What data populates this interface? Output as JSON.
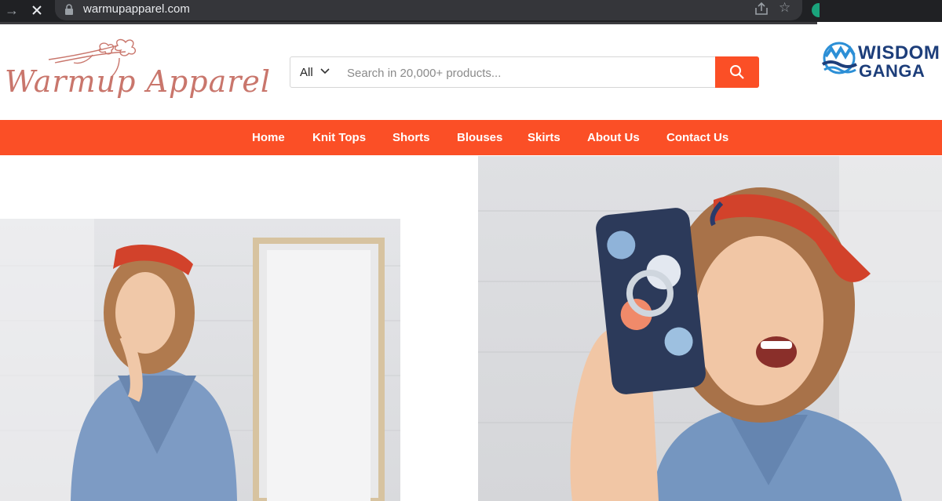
{
  "browser": {
    "url": "warmupapparel.com",
    "icons": [
      "back-arrow-icon",
      "stop-icon",
      "lock-icon",
      "share-icon",
      "bookmark-star-icon"
    ]
  },
  "watermark": {
    "line1": "WISDOM",
    "line2": "GANGA",
    "colors": {
      "navy": "#1d3e7a",
      "blue": "#2c8fd6"
    }
  },
  "header": {
    "logo_text": "Warmup Apparel",
    "search": {
      "category": "All",
      "placeholder": "Search in 20,000+ products..."
    }
  },
  "nav": {
    "items": [
      {
        "label": "Home"
      },
      {
        "label": "Knit Tops"
      },
      {
        "label": "Shorts"
      },
      {
        "label": "Blouses"
      },
      {
        "label": "Skirts"
      },
      {
        "label": "About Us"
      },
      {
        "label": "Contact Us"
      }
    ]
  },
  "hero": {
    "left_image": "woman-denim-jacket-headscarf-mirror",
    "right_image": "woman-selfie-phone-headscarf"
  },
  "colors": {
    "accent": "#fb4f26",
    "logo": "#c9766c"
  }
}
